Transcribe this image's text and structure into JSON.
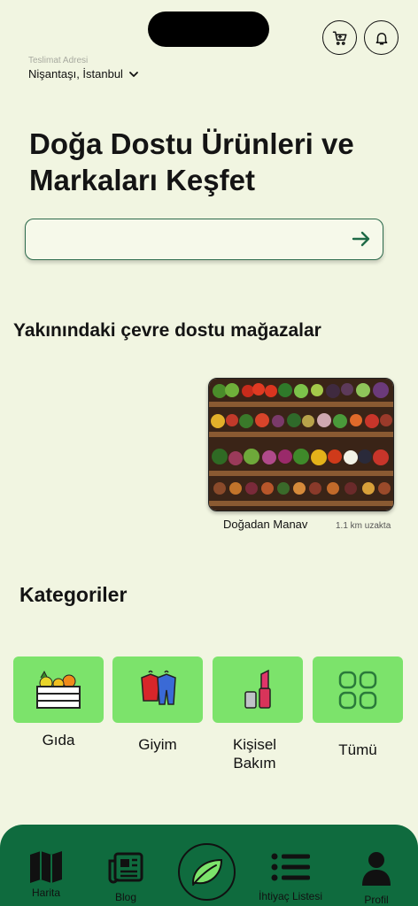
{
  "header": {
    "address_label": "Teslimat Adresi",
    "address_value": "Nişantaşı, İstanbul",
    "icons": [
      "cart-icon",
      "bell-icon",
      "chevron-down-icon"
    ]
  },
  "hero": {
    "line1": "Doğa Dostu Ürünleri ve",
    "line2": "Markaları Keşfet"
  },
  "search": {
    "value": "",
    "placeholder": ""
  },
  "nearby": {
    "title": "Yakınındaki çevre dostu mağazalar",
    "stores": [
      {
        "name": "Doğadan Manav",
        "distance": "1.1 km uzakta"
      }
    ]
  },
  "categories": {
    "title": "Kategoriler",
    "items": [
      {
        "label": "Gıda",
        "icon": "produce-crate-icon"
      },
      {
        "label": "Giyim",
        "icon": "clothes-hanger-icon"
      },
      {
        "label_line1": "Kişisel",
        "label_line2": "Bakım",
        "icon": "lipstick-icon"
      },
      {
        "label": "Tümü",
        "icon": "grid-icon"
      }
    ]
  },
  "tabbar": {
    "items": [
      {
        "label": "Harita",
        "icon": "map-icon"
      },
      {
        "label": "Blog",
        "icon": "newspaper-icon"
      },
      {
        "label": "",
        "icon": "leaf-icon"
      },
      {
        "label": "İhtiyaç Listesi",
        "icon": "list-icon"
      },
      {
        "label": "Profil",
        "icon": "person-icon"
      }
    ]
  },
  "colors": {
    "background": "#f1f5e1",
    "accent_green": "#0f6b3e",
    "category_tile": "#7ce36b"
  }
}
